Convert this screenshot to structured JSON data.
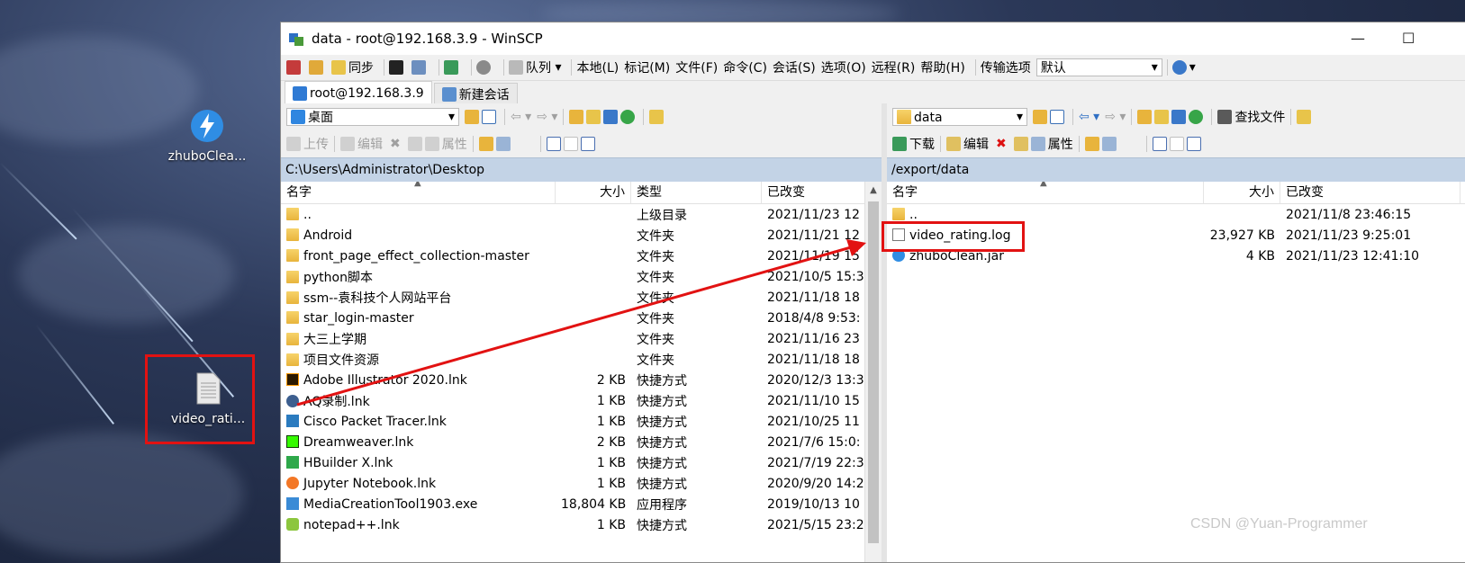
{
  "desktop": {
    "icons": [
      {
        "label": "zhuboClea...",
        "icon": "winscp-bolt-icon"
      },
      {
        "label": "video_rati...",
        "icon": "text-file-icon"
      }
    ]
  },
  "window": {
    "title": "data - root@192.168.3.9 - WinSCP",
    "controls": {
      "minimize": "—",
      "maximize": "☐"
    }
  },
  "toolbar": {
    "sync_label": "同步",
    "queue_label": "队列",
    "menu": [
      "本地(L)",
      "标记(M)",
      "文件(F)",
      "命令(C)",
      "会话(S)",
      "选项(O)",
      "远程(R)",
      "帮助(H)"
    ],
    "transfer_label": "传输选项",
    "transfer_value": "默认"
  },
  "sessions": {
    "tabs": [
      "root@192.168.3.9",
      "新建会话"
    ]
  },
  "local": {
    "location": "桌面",
    "actions": {
      "upload": "上传",
      "edit": "编辑",
      "properties": "属性"
    },
    "path": "C:\\Users\\Administrator\\Desktop",
    "columns": {
      "name": "名字",
      "size": "大小",
      "type": "类型",
      "changed": "已改变"
    },
    "rows": [
      {
        "name": "..",
        "size": "",
        "type": "上级目录",
        "changed": "2021/11/23  12",
        "kind": "updir"
      },
      {
        "name": "Android",
        "size": "",
        "type": "文件夹",
        "changed": "2021/11/21  12",
        "kind": "folder"
      },
      {
        "name": "front_page_effect_collection-master",
        "size": "",
        "type": "文件夹",
        "changed": "2021/11/19  15",
        "kind": "folder"
      },
      {
        "name": "python脚本",
        "size": "",
        "type": "文件夹",
        "changed": "2021/10/5  15:3",
        "kind": "folder"
      },
      {
        "name": "ssm--袁科技个人网站平台",
        "size": "",
        "type": "文件夹",
        "changed": "2021/11/18  18",
        "kind": "folder"
      },
      {
        "name": "star_login-master",
        "size": "",
        "type": "文件夹",
        "changed": "2018/4/8  9:53:",
        "kind": "folder"
      },
      {
        "name": "大三上学期",
        "size": "",
        "type": "文件夹",
        "changed": "2021/11/16  23",
        "kind": "folder"
      },
      {
        "name": "项目文件资源",
        "size": "",
        "type": "文件夹",
        "changed": "2021/11/18  18",
        "kind": "folder"
      },
      {
        "name": "Adobe Illustrator 2020.lnk",
        "size": "2 KB",
        "type": "快捷方式",
        "changed": "2020/12/3  13:3",
        "kind": "ai"
      },
      {
        "name": "AQ录制.lnk",
        "size": "1 KB",
        "type": "快捷方式",
        "changed": "2021/11/10  15",
        "kind": "aq"
      },
      {
        "name": "Cisco Packet Tracer.lnk",
        "size": "1 KB",
        "type": "快捷方式",
        "changed": "2021/10/25  11",
        "kind": "cisco"
      },
      {
        "name": "Dreamweaver.lnk",
        "size": "2 KB",
        "type": "快捷方式",
        "changed": "2021/7/6  15:0:",
        "kind": "dw"
      },
      {
        "name": "HBuilder X.lnk",
        "size": "1 KB",
        "type": "快捷方式",
        "changed": "2021/7/19  22:3",
        "kind": "hb"
      },
      {
        "name": "Jupyter Notebook.lnk",
        "size": "1 KB",
        "type": "快捷方式",
        "changed": "2020/9/20  14:2",
        "kind": "jupyter"
      },
      {
        "name": "MediaCreationTool1903.exe",
        "size": "18,804 KB",
        "type": "应用程序",
        "changed": "2019/10/13  10",
        "kind": "exe"
      },
      {
        "name": "notepad++.lnk",
        "size": "1 KB",
        "type": "快捷方式",
        "changed": "2021/5/15  23:2",
        "kind": "npp"
      }
    ]
  },
  "remote": {
    "location": "data",
    "find_label": "查找文件",
    "actions": {
      "download": "下载",
      "edit": "编辑",
      "properties": "属性"
    },
    "path": "/export/data",
    "columns": {
      "name": "名字",
      "size": "大小",
      "changed": "已改变"
    },
    "rows": [
      {
        "name": "..",
        "size": "",
        "changed": "2021/11/8  23:46:15",
        "kind": "updir"
      },
      {
        "name": "video_rating.log",
        "size": "23,927 KB",
        "changed": "2021/11/23  9:25:01",
        "kind": "doc"
      },
      {
        "name": "zhuboClean.jar",
        "size": "4 KB",
        "changed": "2021/11/23  12:41:10",
        "kind": "jar"
      }
    ]
  },
  "watermark": "CSDN @Yuan-Programmer",
  "colors": {
    "highlight": "#e21212",
    "pathbar": "#c3d3e6"
  }
}
